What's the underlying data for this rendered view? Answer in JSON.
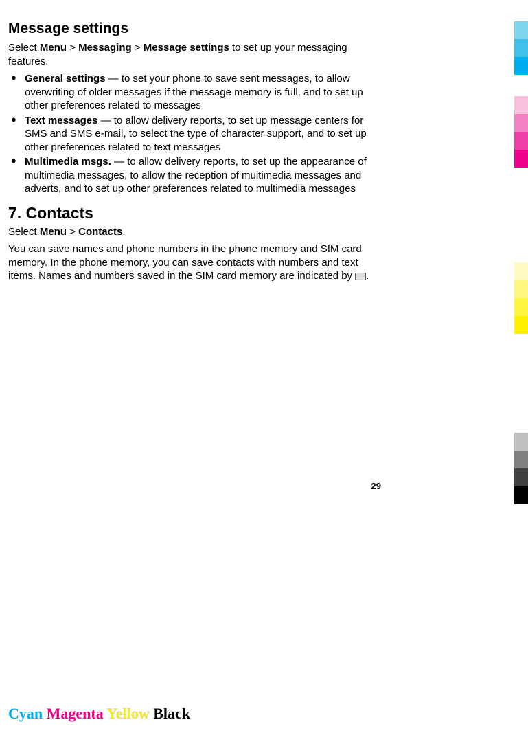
{
  "section1": {
    "title": "Message settings",
    "intro_pre": "Select ",
    "intro_menu": "Menu",
    "intro_gt1": " > ",
    "intro_messaging": "Messaging",
    "intro_gt2": " > ",
    "intro_msgsettings": "Message settings",
    "intro_post": " to set up your messaging features.",
    "bullets": [
      {
        "bold": "General settings",
        "rest": "  —  to set your phone to save sent messages, to allow overwriting of older messages if the message memory is full, and to set up other preferences related to messages"
      },
      {
        "bold": "Text messages",
        "rest": "  — to allow delivery reports, to set up message centers for SMS and SMS e-mail, to select the type of character support, and to set up other preferences related to text messages"
      },
      {
        "bold": "Multimedia msgs.",
        "rest": "  — to allow delivery reports, to set up the appearance of multimedia messages, to allow the reception of multimedia messages and adverts, and to set up other preferences related to multimedia messages"
      }
    ]
  },
  "section2": {
    "title": "7.   Contacts",
    "intro_pre": "Select ",
    "intro_menu": "Menu",
    "intro_gt1": " > ",
    "intro_contacts": "Contacts",
    "intro_post": ".",
    "para2": "You can save names and phone numbers in the phone memory and SIM card memory. In the phone memory, you can save contacts with numbers and text items. Names and numbers saved in the SIM card memory are indicated by ",
    "para2_post": "."
  },
  "page_number": "29",
  "footer": {
    "cyan": "Cyan",
    "magenta": "Magenta",
    "yellow": "Yellow",
    "black": "Black"
  },
  "colorbars": {
    "cyan": [
      "#bce8f7",
      "#7fd4ef",
      "#3fc1e9",
      "#00aeef"
    ],
    "magenta": [
      "#f7c0dd",
      "#f281c2",
      "#ee40a7",
      "#ec008c"
    ],
    "yellow": [
      "#fffac0",
      "#fff780",
      "#fff540",
      "#fff200"
    ],
    "black": [
      "#bfbfbf",
      "#808080",
      "#404040",
      "#000000"
    ]
  }
}
